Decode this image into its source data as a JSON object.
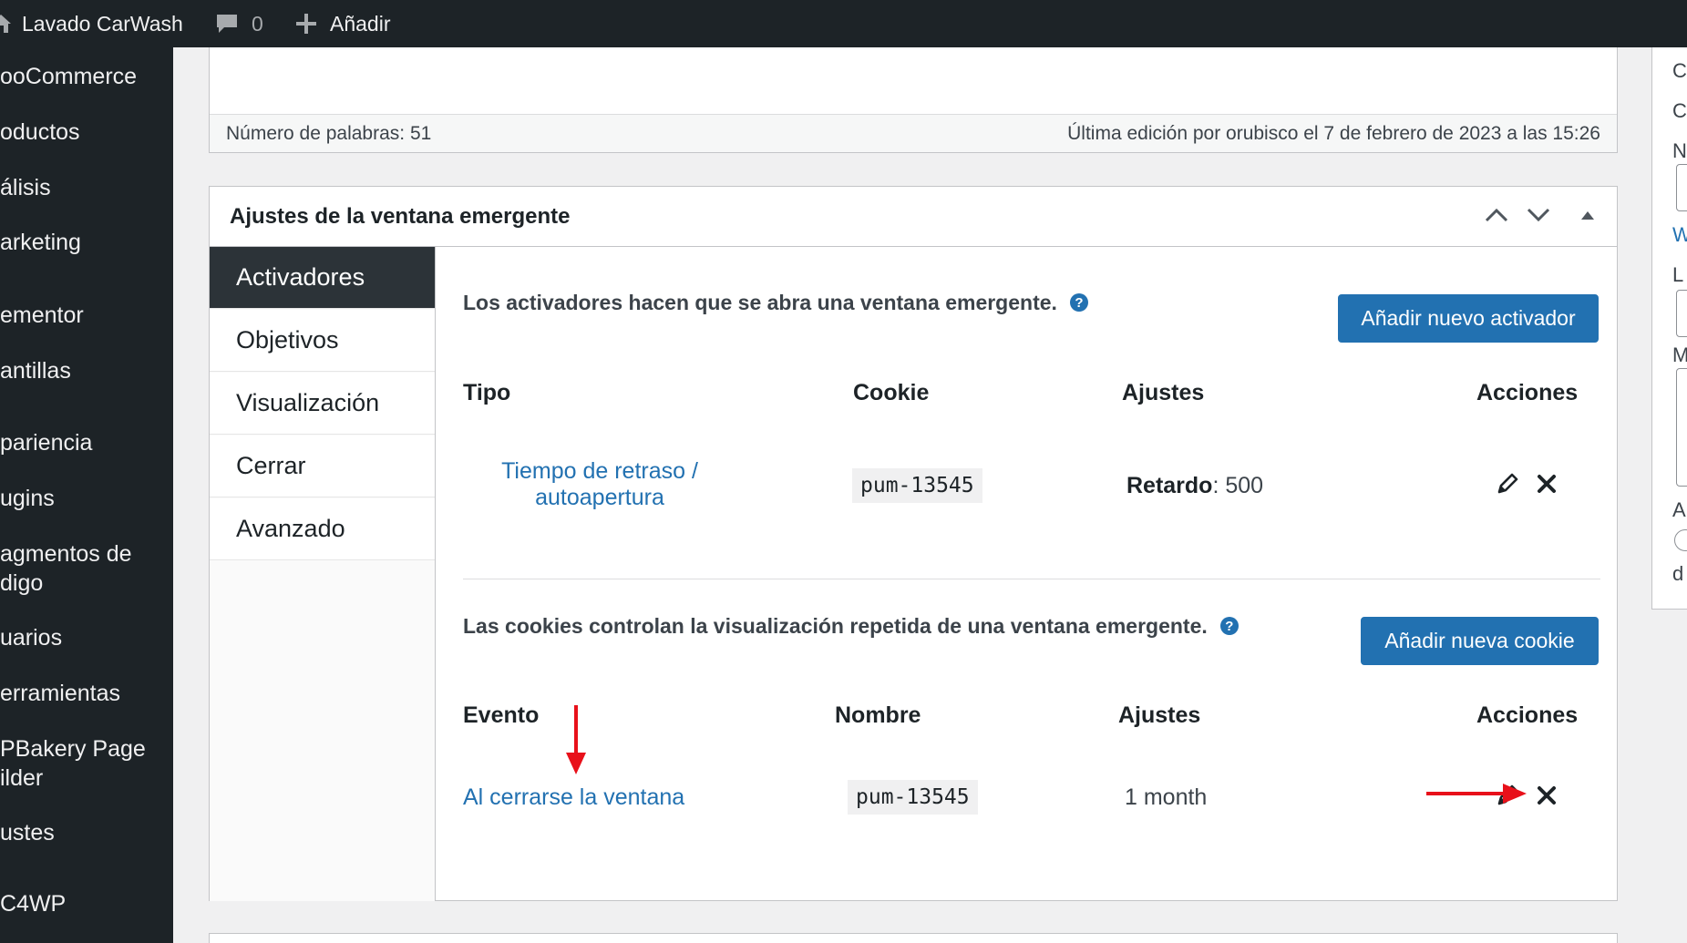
{
  "admin_bar": {
    "site_name": "Lavado CarWash",
    "comments_count": "0",
    "new_label": "Añadir"
  },
  "sidebar": {
    "items": [
      {
        "label": "ooCommerce"
      },
      {
        "label": "oductos"
      },
      {
        "label": "álisis"
      },
      {
        "label": "arketing"
      },
      {
        "label": "ementor"
      },
      {
        "label": "antillas"
      },
      {
        "label": "pariencia"
      },
      {
        "label": "ugins"
      },
      {
        "label": "agmentos de",
        "label2": "digo"
      },
      {
        "label": "uarios"
      },
      {
        "label": "erramientas"
      },
      {
        "label": "PBakery Page",
        "label2": "ilder"
      },
      {
        "label": "ustes"
      },
      {
        "label": "C4WP"
      }
    ]
  },
  "editor": {
    "word_count": "Número de palabras: 51",
    "last_edit": "Última edición por orubisco el 7 de febrero de 2023 a las 15:26"
  },
  "popup_settings": {
    "title": "Ajustes de la ventana emergente",
    "tabs": [
      {
        "label": "Activadores"
      },
      {
        "label": "Objetivos"
      },
      {
        "label": "Visualización"
      },
      {
        "label": "Cerrar"
      },
      {
        "label": "Avanzado"
      }
    ],
    "triggers": {
      "description": "Los activadores hacen que se abra una ventana emergente.",
      "add_button": "Añadir nuevo activador",
      "headers": {
        "type": "Tipo",
        "cookie": "Cookie",
        "settings": "Ajustes",
        "actions": "Acciones"
      },
      "row": {
        "type_line1": "Tiempo de retraso /",
        "type_line2": "autoapertura",
        "cookie": "pum-13545",
        "settings_label": "Retardo",
        "settings_value": ": 500"
      }
    },
    "cookies": {
      "description": "Las cookies controlan la visualización repetida de una ventana emergente.",
      "add_button": "Añadir nueva cookie",
      "headers": {
        "event": "Evento",
        "name": "Nombre",
        "settings": "Ajustes",
        "actions": "Acciones"
      },
      "row": {
        "event": "Al cerrarse la ventana",
        "name": "pum-13545",
        "settings": "1 month"
      }
    }
  },
  "right_column": {
    "letters": [
      "C",
      "C",
      "N",
      "W",
      "L",
      "M",
      "A",
      "d"
    ]
  },
  "colors": {
    "admin_dark": "#1d2327",
    "primary_blue": "#2271b1",
    "annotation_red": "#e8101a"
  }
}
